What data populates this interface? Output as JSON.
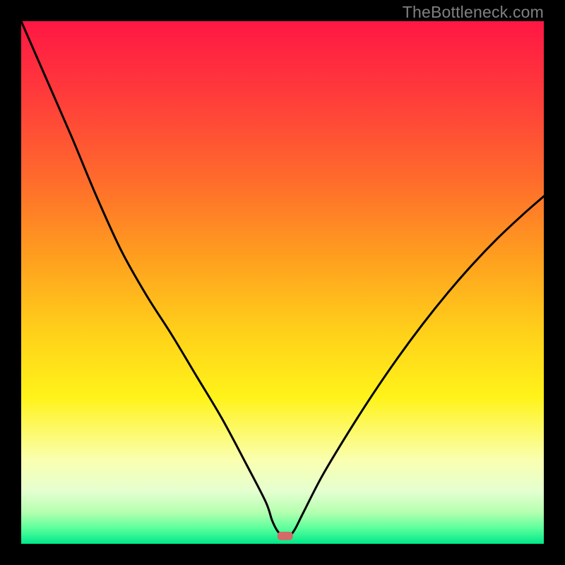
{
  "watermark": "TheBottleneck.com",
  "chart_data": {
    "type": "line",
    "title": "",
    "xlabel": "",
    "ylabel": "",
    "xlim": [
      0,
      100
    ],
    "ylim": [
      0,
      100
    ],
    "minimum_marker": {
      "x": 50.5,
      "y": 1.5
    },
    "gradient_stops": [
      {
        "offset": 0.0,
        "color": "#ff1744"
      },
      {
        "offset": 0.14,
        "color": "#ff3b3b"
      },
      {
        "offset": 0.3,
        "color": "#ff6a2c"
      },
      {
        "offset": 0.45,
        "color": "#ff9e1f"
      },
      {
        "offset": 0.6,
        "color": "#ffd21a"
      },
      {
        "offset": 0.72,
        "color": "#fff31a"
      },
      {
        "offset": 0.84,
        "color": "#faffb0"
      },
      {
        "offset": 0.9,
        "color": "#e4ffd0"
      },
      {
        "offset": 0.94,
        "color": "#b4ffb0"
      },
      {
        "offset": 0.97,
        "color": "#5cff9c"
      },
      {
        "offset": 1.0,
        "color": "#00e889"
      }
    ],
    "series": [
      {
        "name": "left-branch",
        "x": [
          0.0,
          4.8,
          9.6,
          14.4,
          19.2,
          24.0,
          28.8,
          33.6,
          38.4,
          43.2,
          46.8,
          48.0,
          49.0,
          50.0
        ],
        "y": [
          100.0,
          89.0,
          78.0,
          66.5,
          56.0,
          47.5,
          40.0,
          32.0,
          24.0,
          15.0,
          8.0,
          4.5,
          2.5,
          1.5
        ]
      },
      {
        "name": "valley-floor",
        "x": [
          50.0,
          51.5
        ],
        "y": [
          1.5,
          1.5
        ]
      },
      {
        "name": "right-branch",
        "x": [
          51.5,
          52.5,
          54.0,
          57.6,
          62.4,
          67.2,
          72.0,
          76.8,
          81.6,
          86.4,
          91.2,
          96.0,
          100.0
        ],
        "y": [
          1.5,
          3.0,
          6.0,
          13.0,
          21.0,
          28.5,
          35.5,
          42.0,
          48.0,
          53.5,
          58.5,
          63.0,
          66.5
        ]
      }
    ]
  }
}
